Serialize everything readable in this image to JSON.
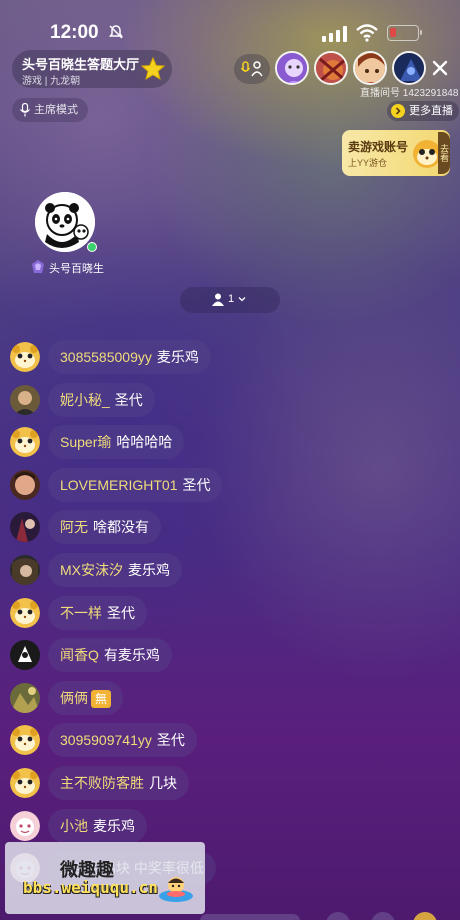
{
  "status": {
    "time": "12:00",
    "battery_level": 0.22,
    "battery_color": "#e04848"
  },
  "room": {
    "title": "头号百晓生答题大厅",
    "category": "游戏 | 九龙朝",
    "host_mode": "主席模式"
  },
  "top_right": {
    "room_id": "直播间号 1423291848",
    "more_live": "更多直播"
  },
  "ad": {
    "title": "卖游戏账号",
    "subtitle": "上YY游仓",
    "tag": "去看"
  },
  "host": {
    "name": "头号百晓生"
  },
  "audience": {
    "count": "1"
  },
  "chat": [
    {
      "name": "3085585009yy",
      "msg": "麦乐鸡",
      "avatar": "hamster"
    },
    {
      "name": "妮小秘_",
      "msg": "圣代",
      "avatar": "photo-brown"
    },
    {
      "name": "Super瑜",
      "msg": "哈哈哈哈",
      "avatar": "hamster"
    },
    {
      "name": "LOVEMERIGHT01",
      "msg": "圣代",
      "avatar": "photo-face"
    },
    {
      "name": "阿无",
      "msg": "啥都没有",
      "avatar": "photo-anime"
    },
    {
      "name": "MX安沫汐",
      "msg": "麦乐鸡",
      "avatar": "photo-dark"
    },
    {
      "name": "不一样",
      "msg": "圣代",
      "avatar": "hamster"
    },
    {
      "name": "闻香Q",
      "msg": "有麦乐鸡",
      "avatar": "photo-black"
    },
    {
      "name": "俩俩",
      "msg": "",
      "badge": "無",
      "avatar": "photo-gold"
    },
    {
      "name": "3095909741yy",
      "msg": "圣代",
      "avatar": "hamster"
    },
    {
      "name": "主不败防客胜",
      "msg": "几块",
      "avatar": "hamster"
    },
    {
      "name": "小池",
      "msg": "麦乐鸡",
      "avatar": "pink"
    },
    {
      "name": "",
      "msg": "麦当劳鸡块 中奖率很低",
      "avatar": "pink"
    }
  ],
  "watermark": {
    "top": "微趣趣",
    "url": "bbs.weiququ.cn"
  }
}
